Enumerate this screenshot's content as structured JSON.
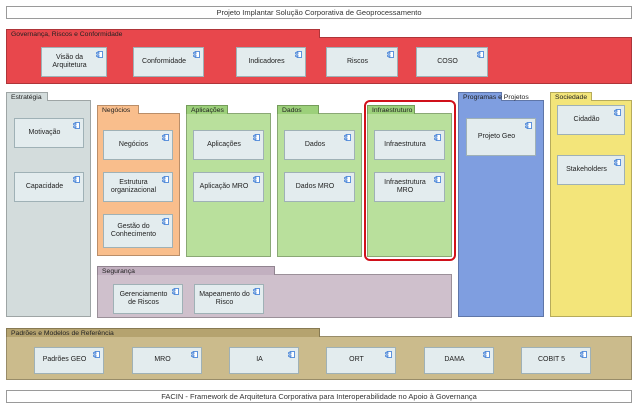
{
  "top_title": "Projeto Implantar Solução Corporativa de Geoprocessamento",
  "bottom_title": "FACIN - Framework de Arquitetura Corporativa para Interoperabilidade no Apoio à Governança",
  "groups": {
    "governanca": {
      "label": "Governança, Riscos e Conformidade",
      "color": "#e8474c",
      "tab_color": "#e8474c",
      "items": [
        "Visão da Arquitetura",
        "Conformidade",
        "Indicadores",
        "Riscos",
        "COSO"
      ]
    },
    "estrategia": {
      "label": "Estratégia",
      "color": "#d3dcdc",
      "tab_color": "#d3dcdc",
      "items": [
        "Motivação",
        "Capacidade"
      ]
    },
    "negocios": {
      "label": "Negócios",
      "color": "#f9be8c",
      "tab_color": "#f9be8c",
      "items": [
        "Negócios",
        "Estrutura organizacional",
        "Gestão do Conhecimento"
      ]
    },
    "aplicacoes": {
      "label": "Aplicações",
      "color": "#b9e09c",
      "tab_color": "#9cd07a",
      "items": [
        "Aplicações",
        "Aplicação MRO"
      ]
    },
    "dados": {
      "label": "Dados",
      "color": "#b9e09c",
      "tab_color": "#9cd07a",
      "items": [
        "Dados",
        "Dados MRO"
      ]
    },
    "infraestrutura": {
      "label": "Infraestruturo",
      "color": "#b9e09c",
      "tab_color": "#9cd07a",
      "items": [
        "Infraestrutura",
        "Infraestrutura MRO"
      ]
    },
    "programas": {
      "label": "Programas e Projetos",
      "color": "#7f9ee0",
      "tab_color": "#7f9ee0",
      "items": [
        "Projeto Geo"
      ]
    },
    "sociedade": {
      "label": "Sociedade",
      "color": "#f3e57a",
      "tab_color": "#f3e57a",
      "items": [
        "Cidadão",
        "Stakeholders"
      ]
    },
    "seguranca": {
      "label": "Segurança",
      "color": "#cfc0cc",
      "tab_color": "#c2b0c0",
      "items": [
        "Gerenciamento de Riscos",
        "Mapeamento do Risco"
      ]
    },
    "padroes": {
      "label": "Padrões e Modelos de Referência",
      "color": "#cbbb8c",
      "tab_color": "#b5a36f",
      "items": [
        "Padrões GEO",
        "MRO",
        "IA",
        "ORT",
        "DAMA",
        "COBIT 5"
      ]
    }
  },
  "highlight_color": "#d0101a",
  "item_icon": "component-icon"
}
